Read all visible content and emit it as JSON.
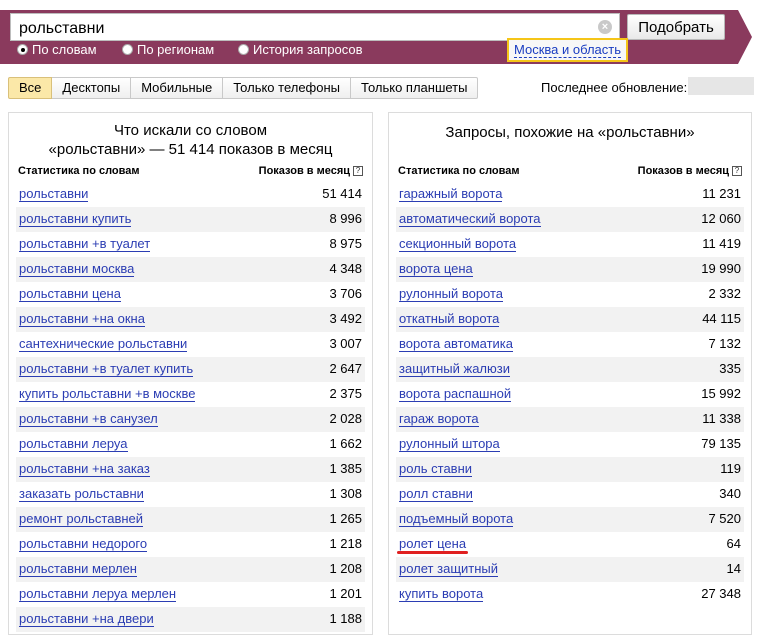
{
  "search": {
    "query": "рольставни",
    "button_label": "Подобрать"
  },
  "radios": [
    {
      "label": "По словам",
      "selected": true
    },
    {
      "label": "По регионам",
      "selected": false
    },
    {
      "label": "История запросов",
      "selected": false
    }
  ],
  "region": "Москва и область",
  "tabs": [
    {
      "label": "Все",
      "active": true
    },
    {
      "label": "Десктопы",
      "active": false
    },
    {
      "label": "Мобильные",
      "active": false
    },
    {
      "label": "Только телефоны",
      "active": false
    },
    {
      "label": "Только планшеты",
      "active": false
    }
  ],
  "last_update_label": "Последнее обновление:",
  "left_panel": {
    "title_line1": "Что искали со словом",
    "title_line2": "«рольставни» — 51 414 показов в месяц",
    "col_keyword": "Статистика по словам",
    "col_count": "Показов в месяц",
    "rows": [
      {
        "keyword": "рольставни",
        "count": "51 414"
      },
      {
        "keyword": "рольставни купить",
        "count": "8 996"
      },
      {
        "keyword": "рольставни +в туалет",
        "count": "8 975"
      },
      {
        "keyword": "рольставни москва",
        "count": "4 348"
      },
      {
        "keyword": "рольставни цена",
        "count": "3 706"
      },
      {
        "keyword": "рольставни +на окна",
        "count": "3 492"
      },
      {
        "keyword": "сантехнические рольставни",
        "count": "3 007"
      },
      {
        "keyword": "рольставни +в туалет купить",
        "count": "2 647"
      },
      {
        "keyword": "купить рольставни +в москве",
        "count": "2 375"
      },
      {
        "keyword": "рольставни +в санузел",
        "count": "2 028"
      },
      {
        "keyword": "рольставни леруа",
        "count": "1 662"
      },
      {
        "keyword": "рольставни +на заказ",
        "count": "1 385"
      },
      {
        "keyword": "заказать рольставни",
        "count": "1 308"
      },
      {
        "keyword": "ремонт рольставней",
        "count": "1 265"
      },
      {
        "keyword": "рольставни недорого",
        "count": "1 218"
      },
      {
        "keyword": "рольставни мерлен",
        "count": "1 208"
      },
      {
        "keyword": "рольставни леруа мерлен",
        "count": "1 201"
      },
      {
        "keyword": "рольставни +на двери",
        "count": "1 188"
      }
    ]
  },
  "right_panel": {
    "title": "Запросы, похожие на «рольставни»",
    "col_keyword": "Статистика по словам",
    "col_count": "Показов в месяц",
    "rows": [
      {
        "keyword": "гаражный ворота",
        "count": "11 231"
      },
      {
        "keyword": "автоматический ворота",
        "count": "12 060"
      },
      {
        "keyword": "секционный ворота",
        "count": "11 419"
      },
      {
        "keyword": "ворота цена",
        "count": "19 990"
      },
      {
        "keyword": "рулонный ворота",
        "count": "2 332"
      },
      {
        "keyword": "откатный ворота",
        "count": "44 115"
      },
      {
        "keyword": "ворота автоматика",
        "count": "7 132"
      },
      {
        "keyword": "защитный жалюзи",
        "count": "335"
      },
      {
        "keyword": "ворота распашной",
        "count": "15 992"
      },
      {
        "keyword": "гараж ворота",
        "count": "11 338"
      },
      {
        "keyword": "рулонный штора",
        "count": "79 135"
      },
      {
        "keyword": "роль ставни",
        "count": "119"
      },
      {
        "keyword": "ролл ставни",
        "count": "340"
      },
      {
        "keyword": "подъемный ворота",
        "count": "7 520"
      },
      {
        "keyword": "ролет цена",
        "count": "64"
      },
      {
        "keyword": "ролет защитный",
        "count": "14"
      },
      {
        "keyword": "купить ворота",
        "count": "27 348"
      }
    ]
  },
  "colors": {
    "topbar": "#8a3a5d",
    "link": "#2b3db3",
    "region_border": "#f5c518",
    "annotation": "#e02020"
  }
}
